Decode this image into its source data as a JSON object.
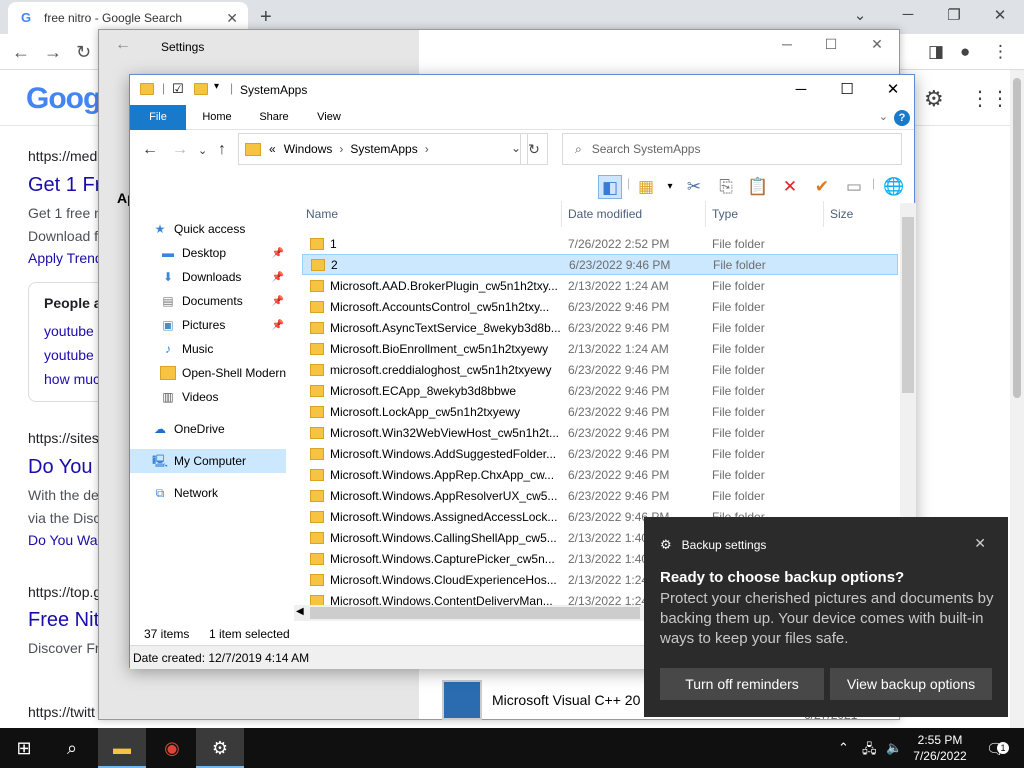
{
  "chrome": {
    "tab_title": "free nitro - Google Search",
    "new_tab": "+",
    "window_controls": [
      "⌄",
      "─",
      "❐",
      "✕"
    ],
    "logo": "Goog",
    "results": [
      {
        "url": "https://med",
        "title": "Get 1 Fr",
        "snippet1": "Get 1 free n",
        "snippet2": "Download f",
        "link": "Apply Trend"
      },
      {
        "paa_title": "People a",
        "paa_items": [
          "youtube",
          "youtube",
          "how muc"
        ]
      },
      {
        "url": "https://sites",
        "title": "Do You",
        "snippet1": "With the de",
        "snippet2": "via the Disc",
        "link": "Do You Wa"
      },
      {
        "url": "https://top.g",
        "title": "Free Nit",
        "snippet1": "Discover Fr"
      },
      {
        "url": "https://twitt"
      }
    ]
  },
  "settings": {
    "title": "Settings",
    "back": "←",
    "section_initial": "Ap",
    "app_name": "Microsoft Visual C++ 20",
    "app_date": "6/27/2021",
    "controls": [
      "─",
      "☐",
      "✕"
    ]
  },
  "explorer": {
    "title": "SystemApps",
    "controls": [
      "─",
      "☐",
      "✕"
    ],
    "ribbon_tabs": [
      "File",
      "Home",
      "Share",
      "View"
    ],
    "address": {
      "chevron": "«",
      "crumbs": [
        "Windows",
        "SystemApps"
      ],
      "sep": "›"
    },
    "search_placeholder": "Search SystemApps",
    "columns": [
      "Name",
      "Date modified",
      "Type",
      "Size"
    ],
    "nav_items": [
      {
        "label": "Quick access",
        "icon": "star-icon",
        "glyph": "★",
        "color": "#3a86d8",
        "pinned": false
      },
      {
        "label": "Desktop",
        "icon": "desktop-icon",
        "glyph": "▬",
        "color": "#3a86d8",
        "pinned": true
      },
      {
        "label": "Downloads",
        "icon": "download-icon",
        "glyph": "⬇",
        "color": "#3a86d8",
        "pinned": true
      },
      {
        "label": "Documents",
        "icon": "documents-icon",
        "glyph": "▤",
        "color": "#777777",
        "pinned": true
      },
      {
        "label": "Pictures",
        "icon": "pictures-icon",
        "glyph": "▣",
        "color": "#4a90c8",
        "pinned": true
      },
      {
        "label": "Music",
        "icon": "music-icon",
        "glyph": "♪",
        "color": "#3a86d8",
        "pinned": false
      },
      {
        "label": "Open-Shell Modern",
        "icon": "folder-icon",
        "glyph": "",
        "color": "#f6c342",
        "pinned": false
      },
      {
        "label": "Videos",
        "icon": "videos-icon",
        "glyph": "▥",
        "color": "#555555",
        "pinned": false
      },
      {
        "label": "OneDrive",
        "icon": "cloud-icon",
        "glyph": "☁",
        "color": "#1e6fc9",
        "pinned": false
      },
      {
        "label": "My Computer",
        "icon": "computer-icon",
        "glyph": "🖳",
        "color": "#3a86d8",
        "pinned": false
      },
      {
        "label": "Network",
        "icon": "network-icon",
        "glyph": "⧉",
        "color": "#3a86d8",
        "pinned": false
      }
    ],
    "files": [
      {
        "name": "1",
        "date": "7/26/2022 2:52 PM",
        "type": "File folder"
      },
      {
        "name": "2",
        "date": "6/23/2022 9:46 PM",
        "type": "File folder"
      },
      {
        "name": "Microsoft.AAD.BrokerPlugin_cw5n1h2txy...",
        "date": "2/13/2022 1:24 AM",
        "type": "File folder"
      },
      {
        "name": "Microsoft.AccountsControl_cw5n1h2txy...",
        "date": "6/23/2022 9:46 PM",
        "type": "File folder"
      },
      {
        "name": "Microsoft.AsyncTextService_8wekyb3d8b...",
        "date": "6/23/2022 9:46 PM",
        "type": "File folder"
      },
      {
        "name": "Microsoft.BioEnrollment_cw5n1h2txyewy",
        "date": "2/13/2022 1:24 AM",
        "type": "File folder"
      },
      {
        "name": "microsoft.creddialoghost_cw5n1h2txyewy",
        "date": "6/23/2022 9:46 PM",
        "type": "File folder"
      },
      {
        "name": "Microsoft.ECApp_8wekyb3d8bbwe",
        "date": "6/23/2022 9:46 PM",
        "type": "File folder"
      },
      {
        "name": "Microsoft.LockApp_cw5n1h2txyewy",
        "date": "6/23/2022 9:46 PM",
        "type": "File folder"
      },
      {
        "name": "Microsoft.Win32WebViewHost_cw5n1h2t...",
        "date": "6/23/2022 9:46 PM",
        "type": "File folder"
      },
      {
        "name": "Microsoft.Windows.AddSuggestedFolder...",
        "date": "6/23/2022 9:46 PM",
        "type": "File folder"
      },
      {
        "name": "Microsoft.Windows.AppRep.ChxApp_cw...",
        "date": "6/23/2022 9:46 PM",
        "type": "File folder"
      },
      {
        "name": "Microsoft.Windows.AppResolverUX_cw5...",
        "date": "6/23/2022 9:46 PM",
        "type": "File folder"
      },
      {
        "name": "Microsoft.Windows.AssignedAccessLock...",
        "date": "6/23/2022 9:46 PM",
        "type": "File folder"
      },
      {
        "name": "Microsoft.Windows.CallingShellApp_cw5...",
        "date": "2/13/2022 1:40",
        "type": ""
      },
      {
        "name": "Microsoft.Windows.CapturePicker_cw5n...",
        "date": "2/13/2022 1:40",
        "type": ""
      },
      {
        "name": "Microsoft.Windows.CloudExperienceHos...",
        "date": "2/13/2022 1:24",
        "type": ""
      },
      {
        "name": "Microsoft.Windows.ContentDeliveryMan...",
        "date": "2/13/2022 1:24",
        "type": ""
      }
    ],
    "selected_index": 1,
    "status_items": "37 items",
    "status_selected": "1 item selected",
    "info": "Date created: 12/7/2019 4:14 AM"
  },
  "toast": {
    "app": "Backup settings",
    "close": "✕",
    "heading": "Ready to choose backup options?",
    "body": "Protect your cherished pictures and documents by backing them up. Your device comes with built-in ways to keep your files safe.",
    "btn_off": "Turn off reminders",
    "btn_view": "View backup options"
  },
  "taskbar": {
    "time": "2:55 PM",
    "date": "7/26/2022",
    "notif_count": "1"
  }
}
